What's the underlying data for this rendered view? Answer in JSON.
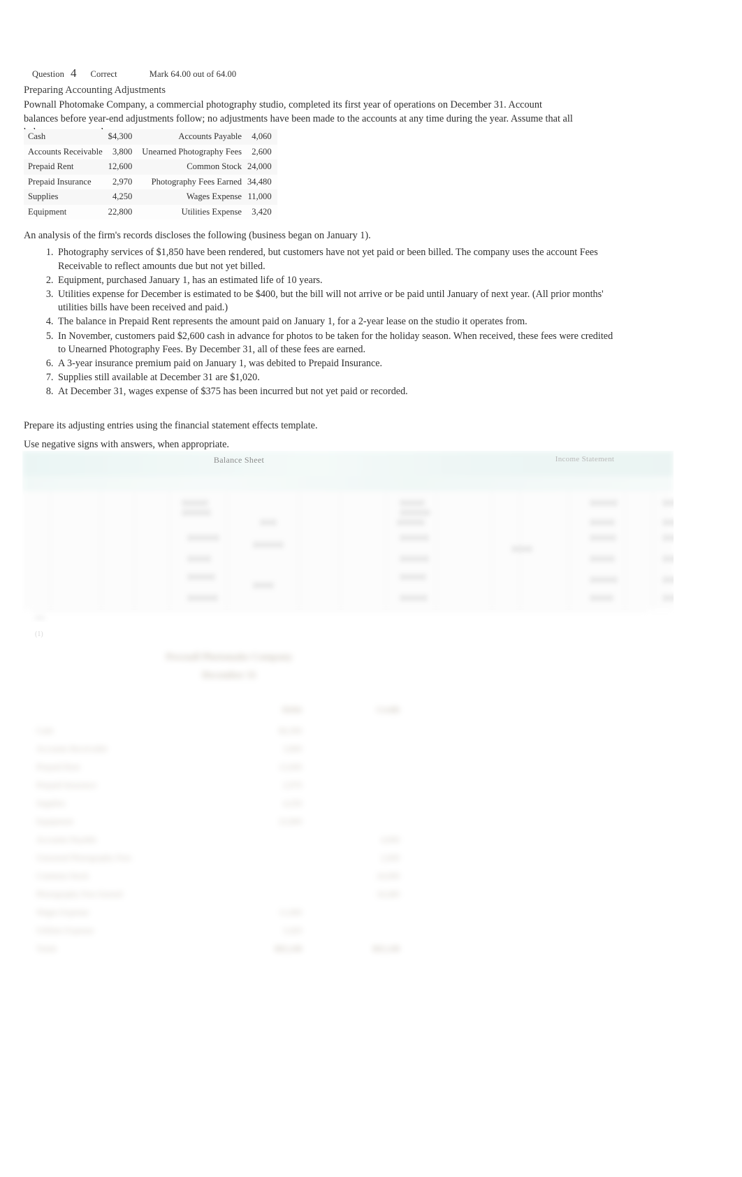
{
  "question": {
    "label": "Question",
    "number": "4",
    "state": "Correct",
    "mark": "Mark 64.00 out of 64.00"
  },
  "content": {
    "title": "Preparing Accounting Adjustments",
    "intro": "Pownall Photomake Company, a commercial photography studio, completed its first year of operations on December 31. Account balances before year-end adjustments follow; no adjustments have been made to the accounts at any time during the year. Assume that all balances are normal.",
    "analysis_lead": "An analysis of the firm's records discloses the following (business began on January 1).",
    "prepare": "Prepare its adjusting entries using the financial statement effects template.",
    "negative_signs": "Use negative signs with answers, when appropriate."
  },
  "trial_balance": {
    "rows": [
      {
        "left_account": "Cash",
        "left_amount": "$4,300",
        "right_account": "Accounts Payable",
        "right_amount": "4,060"
      },
      {
        "left_account": "Accounts Receivable",
        "left_amount": "3,800",
        "right_account": "Unearned Photography Fees",
        "right_amount": "2,600"
      },
      {
        "left_account": "Prepaid Rent",
        "left_amount": "12,600",
        "right_account": "Common Stock",
        "right_amount": "24,000"
      },
      {
        "left_account": "Prepaid Insurance",
        "left_amount": "2,970",
        "right_account": "Photography Fees Earned",
        "right_amount": "34,480"
      },
      {
        "left_account": "Supplies",
        "left_amount": "4,250",
        "right_account": "Wages Expense",
        "right_amount": "11,000"
      },
      {
        "left_account": "Equipment",
        "left_amount": "22,800",
        "right_account": "Utilities Expense",
        "right_amount": "3,420"
      }
    ]
  },
  "adjustments": [
    "Photography services of $1,850 have been rendered, but customers have not yet paid or been billed. The company uses the account Fees Receivable to reflect amounts due but not yet billed.",
    "Equipment, purchased January 1, has an estimated life of 10 years.",
    "Utilities expense for December is estimated to be $400, but the bill will not arrive or be paid until January of next year. (All prior months' utilities bills have been received and paid.)",
    "The balance in Prepaid Rent represents the amount paid on January 1, for a 2-year lease on the studio it operates from.",
    "In November, customers paid $2,600 cash in advance for photos to be taken for the holiday season. When received, these fees were credited to Unearned Photography Fees. By December 31, all of these fees are earned.",
    "A 3-year insurance premium paid on January 1, was debited to Prepaid Insurance.",
    "Supplies still available at December 31 are $1,020.",
    "At December 31, wages expense of $375 has been incurred but not yet paid or recorded."
  ],
  "fset": {
    "balance_sheet_label": "Balance Sheet",
    "income_statement_label": "Income Statement"
  },
  "statement": {
    "company": "Pownall Photomake Company",
    "date": "December 31",
    "debit_header": "Debit",
    "credit_header": "Credit",
    "rows": [
      {
        "account": "Cash",
        "debit": "$4,300",
        "credit": ""
      },
      {
        "account": "Accounts Receivable",
        "debit": "3,800",
        "credit": ""
      },
      {
        "account": "Prepaid Rent",
        "debit": "12,600",
        "credit": ""
      },
      {
        "account": "Prepaid Insurance",
        "debit": "2,970",
        "credit": ""
      },
      {
        "account": "Supplies",
        "debit": "4,250",
        "credit": ""
      },
      {
        "account": "Equipment",
        "debit": "22,800",
        "credit": ""
      },
      {
        "account": "Accounts Payable",
        "debit": "",
        "credit": "4,060"
      },
      {
        "account": "Unearned Photography Fees",
        "debit": "",
        "credit": "2,600"
      },
      {
        "account": "Common Stock",
        "debit": "",
        "credit": "24,000"
      },
      {
        "account": "Photography Fees Earned",
        "debit": "",
        "credit": "34,480"
      },
      {
        "account": "Wages Expense",
        "debit": "11,000",
        "credit": ""
      },
      {
        "account": "Utilities Expense",
        "debit": "3,420",
        "credit": ""
      },
      {
        "account": "Totals",
        "debit": "$65,140",
        "credit": "$65,140"
      }
    ]
  },
  "colors": {
    "text": "#2f2f2f",
    "band": "#dff0ee",
    "statement_text": "#8a7a63"
  }
}
